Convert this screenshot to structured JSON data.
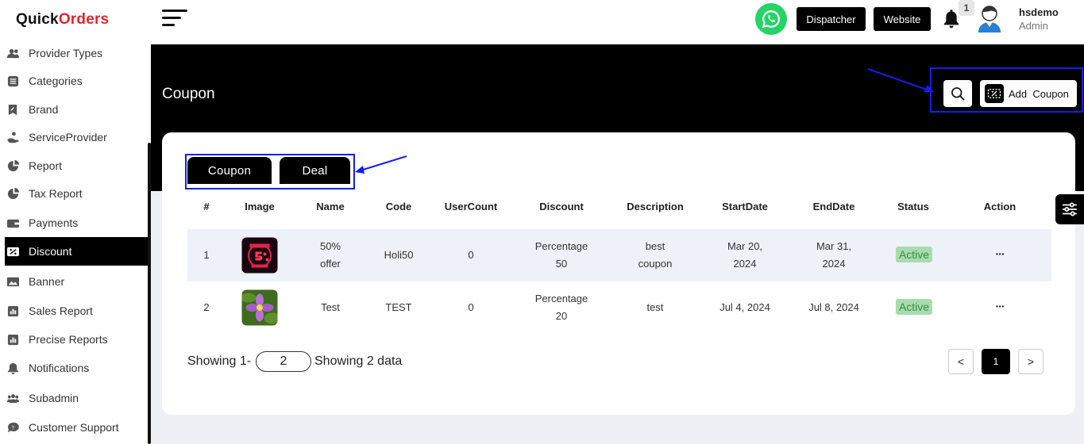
{
  "brand": {
    "logo_prefix": "Quick",
    "logo_suffix": "Orders"
  },
  "sidebar": {
    "items": [
      {
        "label": "Provider Types",
        "icon": "users-icon"
      },
      {
        "label": "Categories",
        "icon": "list-icon"
      },
      {
        "label": "Brand",
        "icon": "tag-icon"
      },
      {
        "label": "ServiceProvider",
        "icon": "hand-icon"
      },
      {
        "label": "Report",
        "icon": "chart-pie-icon"
      },
      {
        "label": "Tax Report",
        "icon": "chart-pie-icon"
      },
      {
        "label": "Payments",
        "icon": "wallet-icon"
      },
      {
        "label": "Discount",
        "icon": "discount-icon",
        "active": true
      },
      {
        "label": "Banner",
        "icon": "image-icon"
      },
      {
        "label": "Sales Report",
        "icon": "report-icon"
      },
      {
        "label": "Precise Reports",
        "icon": "report-icon"
      },
      {
        "label": "Notifications",
        "icon": "bell-icon"
      },
      {
        "label": "Subadmin",
        "icon": "group-icon"
      },
      {
        "label": "Customer Support",
        "icon": "chat-icon"
      }
    ]
  },
  "header": {
    "dispatcher_label": "Dispatcher",
    "website_label": "Website",
    "notification_count": "1",
    "user_name": "hsdemo",
    "user_role": "Admin"
  },
  "page": {
    "title": "Coupon",
    "add_button_label": "Add  Coupon"
  },
  "tabs": [
    {
      "label": "Coupon"
    },
    {
      "label": "Deal"
    }
  ],
  "table": {
    "columns": [
      "#",
      "Image",
      "Name",
      "Code",
      "UserCount",
      "Discount",
      "Description",
      "StartDate",
      "EndDate",
      "Status",
      "Action"
    ],
    "rows": [
      {
        "num": "1",
        "image": "sale-banner",
        "name_l1": "50%",
        "name_l2": "offer",
        "code": "Holi50",
        "user_count": "0",
        "discount_l1": "Percentage",
        "discount_l2": "50",
        "desc_l1": "best",
        "desc_l2": "coupon",
        "start_l1": "Mar 20,",
        "start_l2": "2024",
        "end_l1": "Mar 31,",
        "end_l2": "2024",
        "status": "Active",
        "action": "···"
      },
      {
        "num": "2",
        "image": "purple-flower",
        "name": "Test",
        "code": "TEST",
        "user_count": "0",
        "discount_l1": "Percentage",
        "discount_l2": "20",
        "desc": "test",
        "start": "Jul 4, 2024",
        "end": "Jul 8, 2024",
        "status": "Active",
        "action": "···"
      }
    ]
  },
  "footer": {
    "showing_prefix": "Showing 1-",
    "per_page": "2",
    "showing_suffix": "Showing 2 data",
    "prev": "<",
    "current_page": "1",
    "next": ">"
  },
  "colors": {
    "accent": "#000000",
    "highlight": "#1020e8",
    "active_badge_bg": "#a8dcae",
    "active_badge_text": "#3a8a45",
    "brand_red": "#e3262c",
    "whatsapp": "#25d366"
  }
}
